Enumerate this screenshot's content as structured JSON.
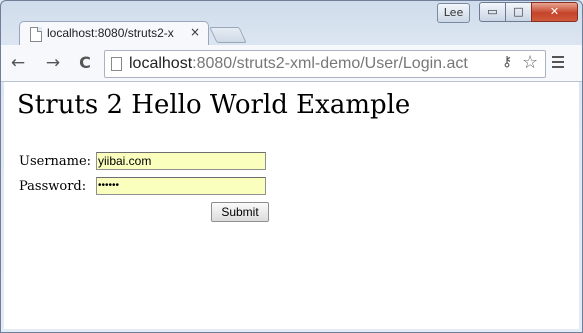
{
  "window": {
    "user_badge": "Lee",
    "minimize_glyph": "▭",
    "maximize_glyph": "□",
    "close_glyph": "✕"
  },
  "tab": {
    "title": "localhost:8080/struts2-x",
    "close_glyph": "×"
  },
  "toolbar": {
    "back_glyph": "←",
    "forward_glyph": "→",
    "reload_glyph": "C",
    "url_host": "localhost",
    "url_rest": ":8080/struts2-xml-demo/User/Login.act",
    "key_glyph": "⚷",
    "star_glyph": "☆"
  },
  "page": {
    "heading": "Struts 2 Hello World Example",
    "username_label": "Username:",
    "username_value": "yiibai.com",
    "password_label": "Password:",
    "password_mask": "••••••",
    "submit_label": "Submit"
  },
  "colors": {
    "autofill_bg": "#faffbd",
    "close_button": "#c5442a"
  }
}
